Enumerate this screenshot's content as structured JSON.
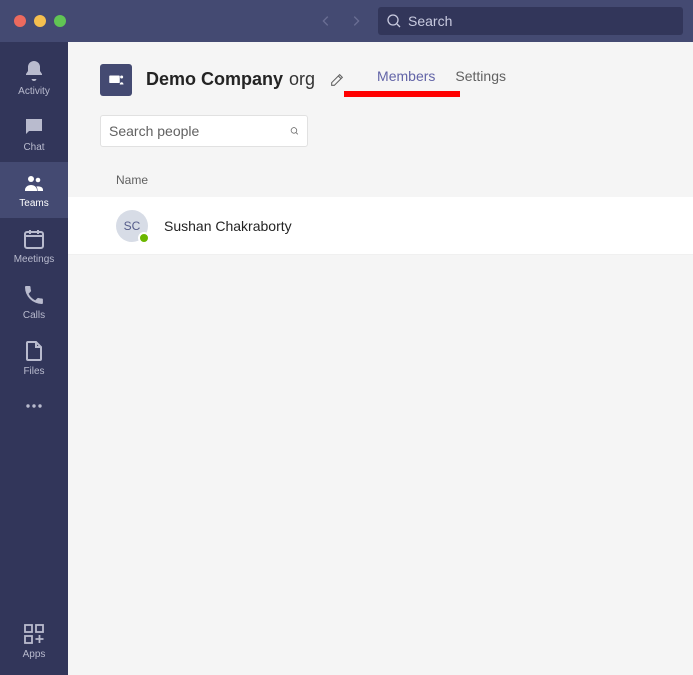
{
  "titlebar": {
    "search_placeholder": "Search"
  },
  "rail": {
    "items": [
      {
        "id": "activity",
        "label": "Activity",
        "icon": "bell"
      },
      {
        "id": "chat",
        "label": "Chat",
        "icon": "chat"
      },
      {
        "id": "teams",
        "label": "Teams",
        "icon": "people",
        "active": true
      },
      {
        "id": "meetings",
        "label": "Meetings",
        "icon": "calendar"
      },
      {
        "id": "calls",
        "label": "Calls",
        "icon": "phone"
      },
      {
        "id": "files",
        "label": "Files",
        "icon": "file"
      }
    ],
    "more_label": "",
    "apps_label": "Apps"
  },
  "header": {
    "team_name": "Demo Company",
    "team_suffix": "org"
  },
  "tabs": [
    {
      "id": "members",
      "label": "Members",
      "active": true
    },
    {
      "id": "settings",
      "label": "Settings",
      "active": false
    }
  ],
  "search_people": {
    "placeholder": "Search people"
  },
  "list": {
    "header_name": "Name",
    "rows": [
      {
        "initials": "SC",
        "name": "Sushan Chakraborty",
        "presence": "available"
      }
    ]
  }
}
